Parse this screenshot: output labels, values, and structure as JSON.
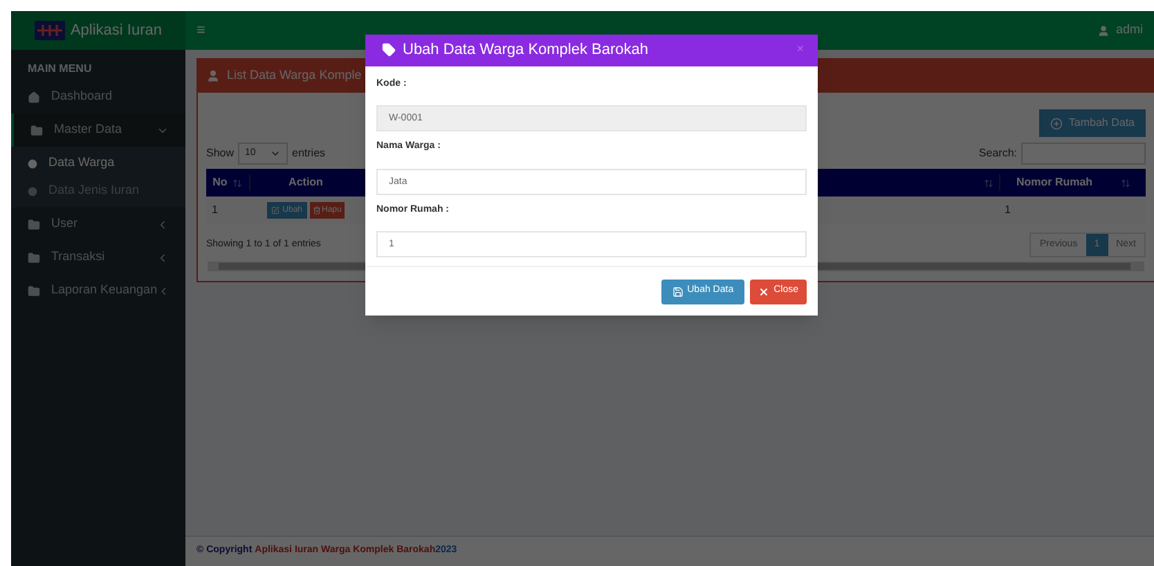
{
  "header": {
    "brand": "Aplikasi Iuran",
    "menu_glyph": "≡",
    "user": "admi"
  },
  "sidebar": {
    "section": "MAIN MENU",
    "items": [
      {
        "label": "Dashboard",
        "kind": "link",
        "selected": false
      },
      {
        "label": "Master Data",
        "kind": "tree",
        "expanded": true,
        "selected": true,
        "children": [
          {
            "label": "Data Warga",
            "selected": true
          },
          {
            "label": "Data Jenis Iuran",
            "selected": false
          }
        ]
      },
      {
        "label": "User",
        "kind": "tree",
        "expanded": false,
        "selected": false
      },
      {
        "label": "Transaksi",
        "kind": "tree",
        "expanded": false,
        "selected": false
      },
      {
        "label": "Laporan Keuangan",
        "kind": "tree",
        "expanded": false,
        "selected": false
      }
    ]
  },
  "panel": {
    "title": "List Data Warga Komple",
    "add_button": "Tambah Data",
    "show_label": "Show",
    "entries_select": "10",
    "entries_label": "entries",
    "search_label": "Search:",
    "columns": [
      "No",
      "Action",
      "Nomor Rumah"
    ],
    "rows": [
      {
        "no": "1",
        "actions": [
          "Ubah",
          "Hapu"
        ],
        "nomor_rumah": "1"
      }
    ],
    "info": "Showing 1 to 1 of 1 entries",
    "pagination": [
      {
        "label": "Previous",
        "selected": false
      },
      {
        "label": "1",
        "selected": true
      },
      {
        "label": "Next",
        "selected": false
      }
    ]
  },
  "modal": {
    "title": "Ubah Data Warga Komplek Barokah",
    "close": "×",
    "fields": [
      {
        "label": "Kode :",
        "value": "W-0001",
        "disabled": true
      },
      {
        "label": "Nama Warga :",
        "value": "Jata",
        "disabled": false
      },
      {
        "label": "Nomor Rumah :",
        "value": "1",
        "disabled": false
      }
    ],
    "buttons": [
      {
        "label": "Ubah Data",
        "kind": "save"
      },
      {
        "label": "Close",
        "kind": "close"
      }
    ]
  },
  "footer": {
    "copyright": "© Copyright",
    "app": "Aplikasi Iuran Warga Komplek Barokah",
    "year": "2023"
  }
}
